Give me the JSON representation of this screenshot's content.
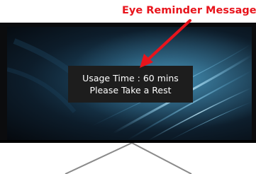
{
  "callout": {
    "label": "Eye Reminder Message",
    "color": "#e8141c"
  },
  "reminder": {
    "line1": "Usage Time : 60 mins",
    "line2": "Please Take a Rest"
  },
  "monitor": {
    "bezel_color": "#0b0c0e",
    "stand_color": "#8a8a8a"
  }
}
